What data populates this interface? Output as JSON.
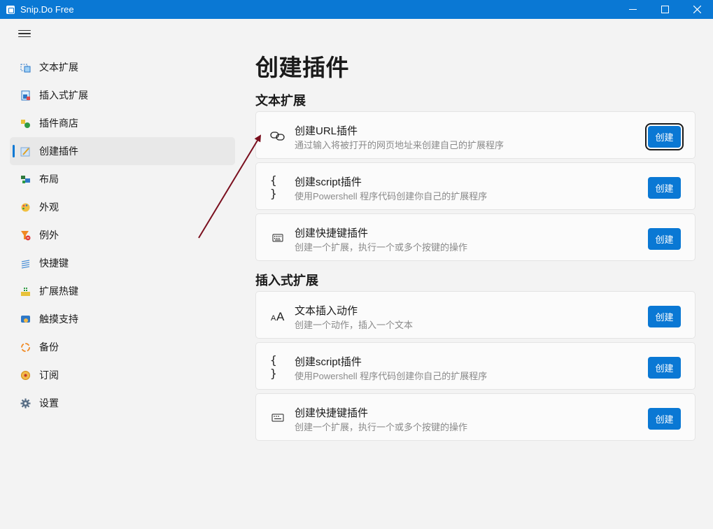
{
  "window": {
    "title": "Snip.Do Free",
    "accent": "#0a78d4"
  },
  "sidebar": {
    "menu_icon": "hamburger-icon",
    "items": [
      {
        "label": "文本扩展",
        "icon": "text-expand-icon"
      },
      {
        "label": "插入式扩展",
        "icon": "insert-expand-icon"
      },
      {
        "label": "插件商店",
        "icon": "plugin-store-icon"
      },
      {
        "label": "创建插件",
        "icon": "create-plugin-icon",
        "selected": true
      },
      {
        "label": "布局",
        "icon": "layout-icon"
      },
      {
        "label": "外观",
        "icon": "palette-icon"
      },
      {
        "label": "例外",
        "icon": "exception-icon"
      },
      {
        "label": "快捷键",
        "icon": "shortcut-icon"
      },
      {
        "label": "扩展热键",
        "icon": "hotkey-icon"
      },
      {
        "label": "触摸支持",
        "icon": "touch-icon"
      },
      {
        "label": "备份",
        "icon": "backup-icon"
      },
      {
        "label": "订阅",
        "icon": "subscribe-icon"
      },
      {
        "label": "设置",
        "icon": "gear-icon"
      }
    ]
  },
  "main": {
    "title": "创建插件",
    "sections": [
      {
        "title": "文本扩展",
        "cards": [
          {
            "title": "创建URL插件",
            "desc": "通过输入将被打开的网页地址来创建自己的扩展程序",
            "icon": "link-icon",
            "button": "创建"
          },
          {
            "title": "创建script插件",
            "desc": "使用Powershell 程序代码创建你自己的扩展程序",
            "icon": "braces-icon",
            "button": "创建"
          },
          {
            "title": "创建快捷键插件",
            "desc": "创建一个扩展，执行一个或多个按键的操作",
            "icon": "keyboard-icon",
            "button": "创建"
          }
        ]
      },
      {
        "title": "插入式扩展",
        "cards": [
          {
            "title": "文本插入动作",
            "desc": "创建一个动作，插入一个文本",
            "icon": "font-size-icon",
            "button": "创建"
          },
          {
            "title": "创建script插件",
            "desc": "使用Powershell 程序代码创建你自己的扩展程序",
            "icon": "braces-icon",
            "button": "创建"
          },
          {
            "title": "创建快捷键插件",
            "desc": "创建一个扩展，执行一个或多个按键的操作",
            "icon": "keyboard-icon",
            "button": "创建"
          }
        ]
      }
    ]
  },
  "annotation": {
    "arrow_color": "#7a0f1e"
  }
}
